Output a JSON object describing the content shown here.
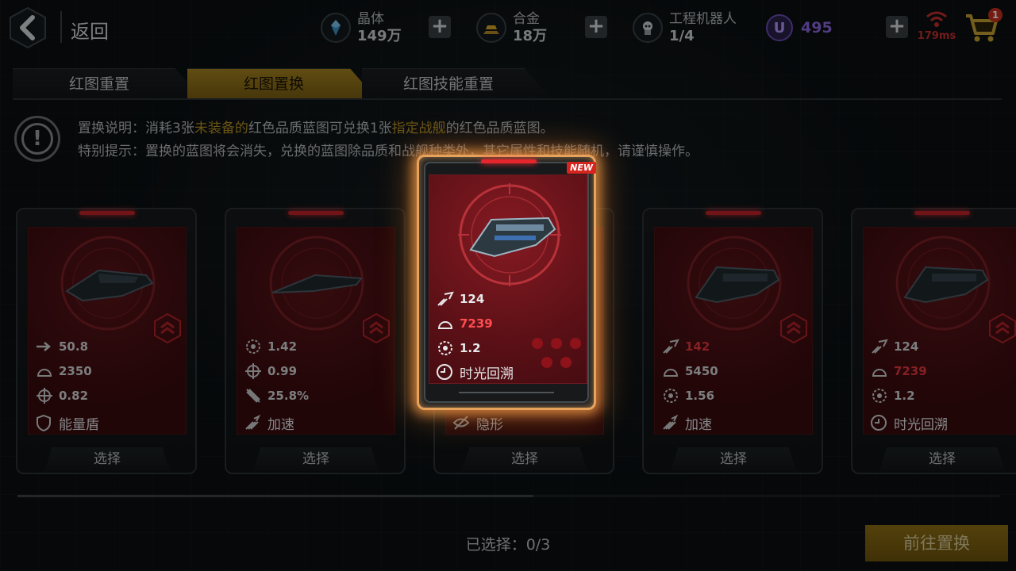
{
  "header": {
    "back_label": "返回",
    "resources": [
      {
        "name": "晶体",
        "value": "149万",
        "icon": "crystal-icon"
      },
      {
        "name": "合金",
        "value": "18万",
        "icon": "alloy-icon"
      },
      {
        "name": "工程机器人",
        "value": "1/4",
        "icon": "robot-icon"
      }
    ],
    "u_currency": {
      "symbol": "U",
      "value": "495"
    },
    "plus_label": "+",
    "ping": "179ms",
    "cart_badge": "1"
  },
  "tabs": [
    {
      "label": "红图重置",
      "active": false
    },
    {
      "label": "红图置换",
      "active": true
    },
    {
      "label": "红图技能重置",
      "active": false
    }
  ],
  "info": {
    "line1": {
      "pre": "置换说明：消耗3张",
      "hl1": "未装备的",
      "mid": "红色品质蓝图可兑换1张",
      "hl2": "指定战舰",
      "post": "的红色品质蓝图。"
    },
    "line2": "特别提示：置换的蓝图将会消失，兑换的蓝图除品质和战舰种类外，其它属性和技能随机，请谨慎操作。",
    "excl": "!"
  },
  "cards": [
    {
      "stats": [
        {
          "icon": "speed-arrow-icon",
          "value": "50.8",
          "red": false
        },
        {
          "icon": "armor-icon",
          "value": "2350",
          "red": false
        },
        {
          "icon": "crosshair-icon",
          "value": "0.82",
          "red": false
        }
      ],
      "skill": {
        "icon": "shield-skill-icon",
        "label": "能量盾"
      },
      "select": "选择"
    },
    {
      "stats": [
        {
          "icon": "gear-icon",
          "value": "1.42",
          "red": false
        },
        {
          "icon": "crosshair-icon",
          "value": "0.99",
          "red": false
        },
        {
          "icon": "missile-icon",
          "value": "25.8%",
          "red": false
        }
      ],
      "skill": {
        "icon": "boost-skill-icon",
        "label": "加速"
      },
      "select": "选择"
    },
    {
      "stats": [],
      "skill": {
        "icon": "stealth-skill-icon",
        "label": "隐形"
      },
      "select": "选择"
    },
    {
      "stats": [
        {
          "icon": "damage-icon",
          "value": "142",
          "red": true
        },
        {
          "icon": "armor-icon",
          "value": "5450",
          "red": false
        },
        {
          "icon": "gear-icon",
          "value": "1.56",
          "red": false
        }
      ],
      "skill": {
        "icon": "boost-skill-icon",
        "label": "加速"
      },
      "select": "选择"
    },
    {
      "stats": [
        {
          "icon": "damage-icon",
          "value": "124",
          "red": false
        },
        {
          "icon": "armor-icon",
          "value": "7239",
          "red": true
        },
        {
          "icon": "gear-icon",
          "value": "1.2",
          "red": false
        }
      ],
      "skill": {
        "icon": "time-skill-icon",
        "label": "时光回溯"
      },
      "select": "选择"
    }
  ],
  "hero_card": {
    "new_tag": "NEW",
    "stats": [
      {
        "icon": "damage-icon",
        "value": "124",
        "red": false
      },
      {
        "icon": "armor-icon",
        "value": "7239",
        "red": true
      },
      {
        "icon": "gear-icon",
        "value": "1.2",
        "red": false
      }
    ],
    "skill": {
      "icon": "time-skill-icon",
      "label": "时光回溯"
    }
  },
  "footer": {
    "selected_label": "已选择：0/3",
    "goto_label": "前往置换"
  },
  "colors": {
    "accent_gold": "#a68420",
    "red_value": "#e5383e",
    "ping_red": "#c7302e",
    "u_purple": "#8c68e0"
  }
}
